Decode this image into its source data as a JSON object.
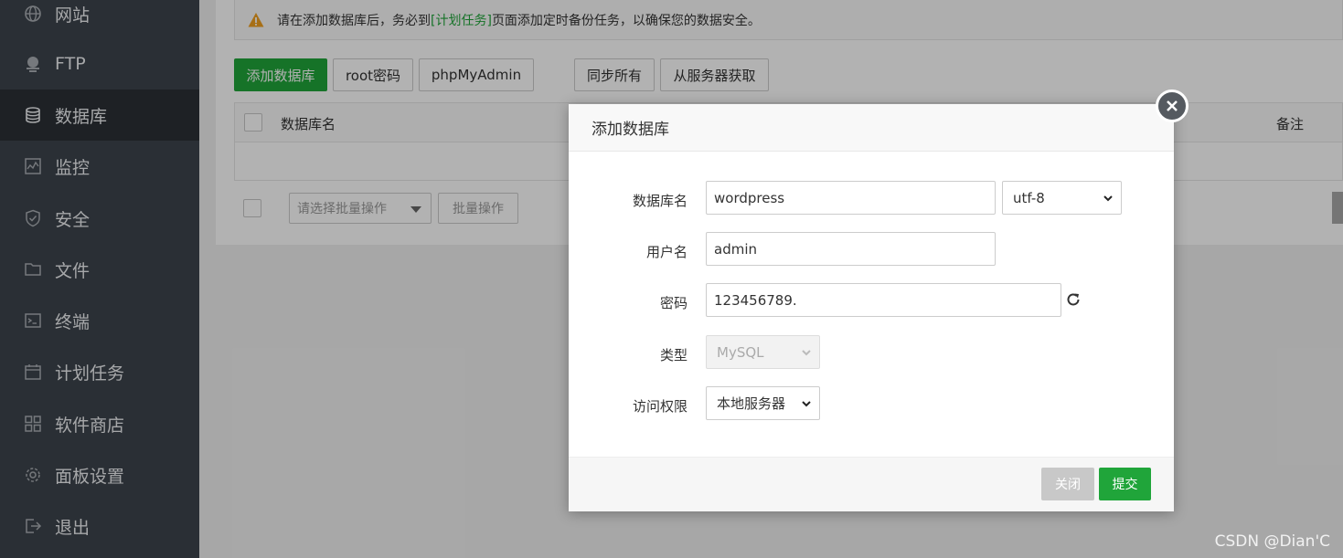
{
  "sidebar": {
    "items": [
      {
        "label": "网站",
        "icon": "globe-icon"
      },
      {
        "label": "FTP",
        "icon": "ftp-icon"
      },
      {
        "label": "数据库",
        "icon": "database-icon",
        "active": true
      },
      {
        "label": "监控",
        "icon": "monitor-icon"
      },
      {
        "label": "安全",
        "icon": "shield-icon"
      },
      {
        "label": "文件",
        "icon": "folder-icon"
      },
      {
        "label": "终端",
        "icon": "terminal-icon"
      },
      {
        "label": "计划任务",
        "icon": "calendar-icon"
      },
      {
        "label": "软件商店",
        "icon": "apps-icon"
      },
      {
        "label": "面板设置",
        "icon": "gear-icon"
      },
      {
        "label": "退出",
        "icon": "logout-icon"
      }
    ]
  },
  "notice": {
    "before": "请在添加数据库后，务必到",
    "link": "[计划任务]",
    "after": "页面添加定时备份任务，以确保您的数据安全。"
  },
  "toolbar": {
    "add_db": "添加数据库",
    "root_pw": "root密码",
    "phpmyadmin": "phpMyAdmin",
    "sync_all": "同步所有",
    "fetch_server": "从服务器获取"
  },
  "table": {
    "col_name": "数据库名",
    "col_note": "备注"
  },
  "batch": {
    "placeholder": "请选择批量操作",
    "button": "批量操作"
  },
  "modal": {
    "title": "添加数据库",
    "db_name_label": "数据库名",
    "db_name_value": "wordpress",
    "charset_value": "utf-8",
    "username_label": "用户名",
    "username_value": "admin",
    "password_label": "密码",
    "password_value": "123456789.",
    "type_label": "类型",
    "type_value": "MySQL",
    "access_label": "访问权限",
    "access_value": "本地服务器",
    "close_btn": "关闭",
    "submit_btn": "提交"
  },
  "watermark": "CSDN @Dian'C",
  "colors": {
    "accent": "#20a53a",
    "sidebar_bg": "#3d444c",
    "sidebar_active": "#2b3036"
  }
}
